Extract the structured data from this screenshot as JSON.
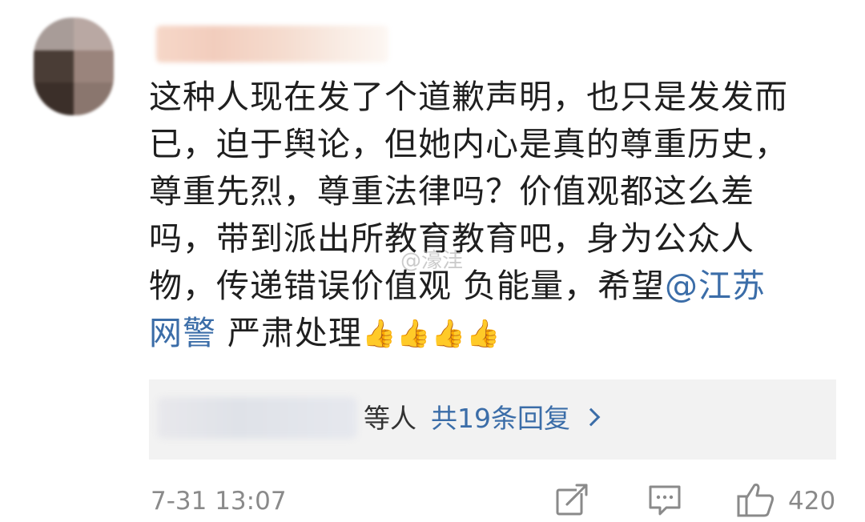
{
  "comment": {
    "line1": "这种人现在发了个道歉声明，也只是发发而",
    "line2": "已，迫于舆论，但她内心是真的尊重历史，",
    "line3": "尊重先烈，尊重法律吗？价值观都这么差",
    "line4": "吗，带到派出所教育教育吧，身为公众人",
    "line5_text": "物，传递错误价值观 负能量，希望",
    "line5_mention": "@江苏",
    "line6_mention": "网警",
    "line6_text": " 严肃处理",
    "emojis": [
      "👍",
      "👍",
      "👍",
      "👍"
    ]
  },
  "watermark": "@濠洼",
  "replies": {
    "suffix": "等人",
    "link": "共19条回复"
  },
  "footer": {
    "timestamp": "7-31 13:07",
    "like_count": "420"
  },
  "icons": {
    "share": "share-icon",
    "comment": "comment-icon",
    "like": "thumbs-up-icon"
  },
  "colors": {
    "link": "#3b6da8",
    "text": "#1f1f1f",
    "muted": "#8a8a8a",
    "reply_bg": "#f2f2f2"
  }
}
